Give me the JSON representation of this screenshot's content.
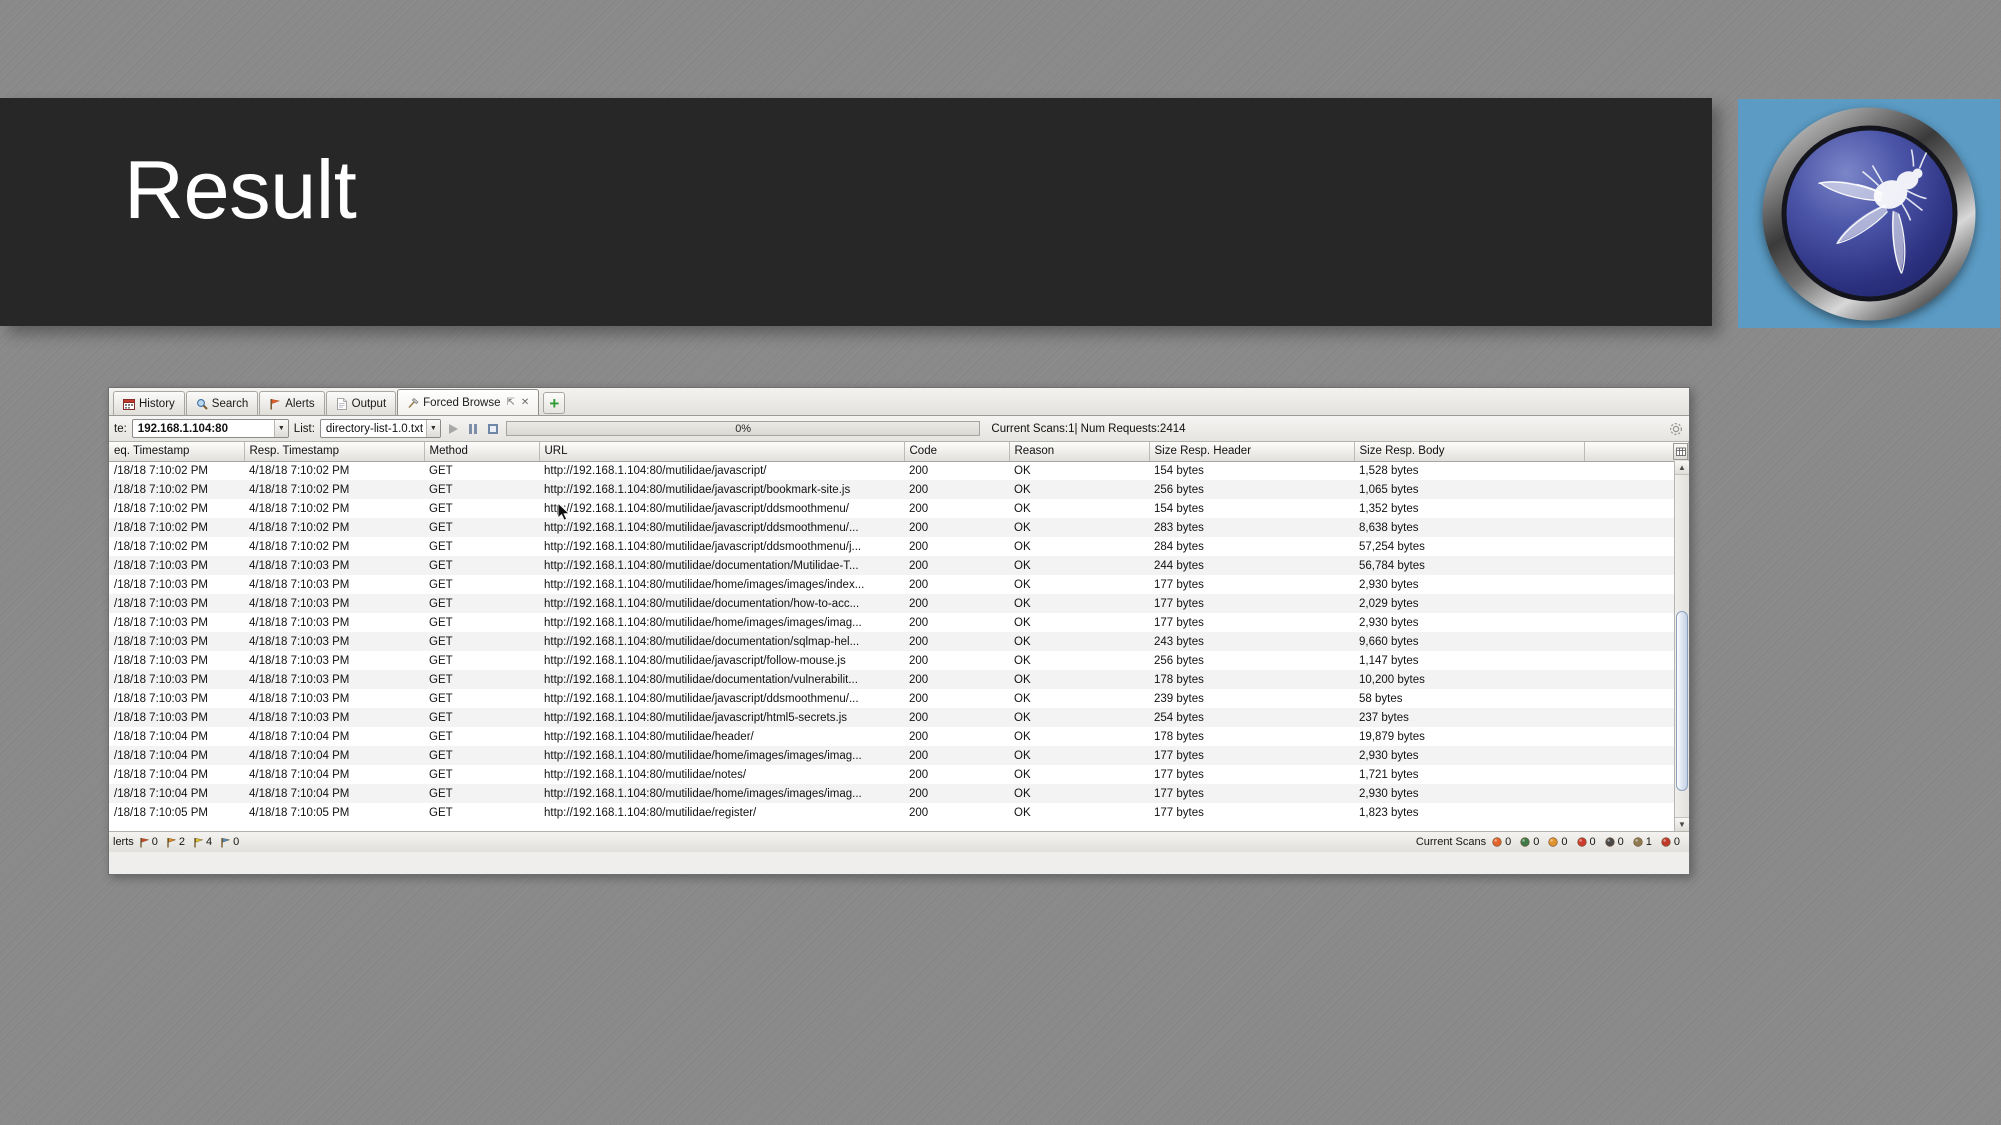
{
  "slide": {
    "title": "Result"
  },
  "logo": {
    "name": "owasp-zap-logo",
    "background_color": "#5b9bc4",
    "disc_color": "#3a4296"
  },
  "app": {
    "tabs": [
      {
        "label": "History",
        "icon": "calendar-icon",
        "active": false,
        "closable": false
      },
      {
        "label": "Search",
        "icon": "magnifier-icon",
        "active": false,
        "closable": false
      },
      {
        "label": "Alerts",
        "icon": "flag-icon",
        "active": false,
        "closable": false
      },
      {
        "label": "Output",
        "icon": "document-icon",
        "active": false,
        "closable": false
      },
      {
        "label": "Forced Browse",
        "icon": "hammer-icon",
        "active": true,
        "closable": true
      }
    ],
    "add_tab_label": "+",
    "toolbar": {
      "site_label": "te:",
      "site_value": "192.168.1.104:80",
      "list_label": "List:",
      "list_value": "directory-list-1.0.txt",
      "progress_text": "0%",
      "progress_percent": 0,
      "scans_text": "Current Scans:1| Num Requests:2414"
    },
    "table": {
      "columns": [
        "eq. Timestamp",
        "Resp. Timestamp",
        "Method",
        "URL",
        "Code",
        "Reason",
        "Size Resp. Header",
        "Size Resp. Body"
      ],
      "rows": [
        [
          "/18/18 7:10:02 PM",
          "4/18/18 7:10:02 PM",
          "GET",
          "http://192.168.1.104:80/mutilidae/javascript/",
          "200",
          "OK",
          "154 bytes",
          "1,528 bytes"
        ],
        [
          "/18/18 7:10:02 PM",
          "4/18/18 7:10:02 PM",
          "GET",
          "http://192.168.1.104:80/mutilidae/javascript/bookmark-site.js",
          "200",
          "OK",
          "256 bytes",
          "1,065 bytes"
        ],
        [
          "/18/18 7:10:02 PM",
          "4/18/18 7:10:02 PM",
          "GET",
          "http://192.168.1.104:80/mutilidae/javascript/ddsmoothmenu/",
          "200",
          "OK",
          "154 bytes",
          "1,352 bytes"
        ],
        [
          "/18/18 7:10:02 PM",
          "4/18/18 7:10:02 PM",
          "GET",
          "http://192.168.1.104:80/mutilidae/javascript/ddsmoothmenu/...",
          "200",
          "OK",
          "283 bytes",
          "8,638 bytes"
        ],
        [
          "/18/18 7:10:02 PM",
          "4/18/18 7:10:02 PM",
          "GET",
          "http://192.168.1.104:80/mutilidae/javascript/ddsmoothmenu/j...",
          "200",
          "OK",
          "284 bytes",
          "57,254 bytes"
        ],
        [
          "/18/18 7:10:03 PM",
          "4/18/18 7:10:03 PM",
          "GET",
          "http://192.168.1.104:80/mutilidae/documentation/Mutilidae-T...",
          "200",
          "OK",
          "244 bytes",
          "56,784 bytes"
        ],
        [
          "/18/18 7:10:03 PM",
          "4/18/18 7:10:03 PM",
          "GET",
          "http://192.168.1.104:80/mutilidae/home/images/images/index...",
          "200",
          "OK",
          "177 bytes",
          "2,930 bytes"
        ],
        [
          "/18/18 7:10:03 PM",
          "4/18/18 7:10:03 PM",
          "GET",
          "http://192.168.1.104:80/mutilidae/documentation/how-to-acc...",
          "200",
          "OK",
          "177 bytes",
          "2,029 bytes"
        ],
        [
          "/18/18 7:10:03 PM",
          "4/18/18 7:10:03 PM",
          "GET",
          "http://192.168.1.104:80/mutilidae/home/images/images/imag...",
          "200",
          "OK",
          "177 bytes",
          "2,930 bytes"
        ],
        [
          "/18/18 7:10:03 PM",
          "4/18/18 7:10:03 PM",
          "GET",
          "http://192.168.1.104:80/mutilidae/documentation/sqlmap-hel...",
          "200",
          "OK",
          "243 bytes",
          "9,660 bytes"
        ],
        [
          "/18/18 7:10:03 PM",
          "4/18/18 7:10:03 PM",
          "GET",
          "http://192.168.1.104:80/mutilidae/javascript/follow-mouse.js",
          "200",
          "OK",
          "256 bytes",
          "1,147 bytes"
        ],
        [
          "/18/18 7:10:03 PM",
          "4/18/18 7:10:03 PM",
          "GET",
          "http://192.168.1.104:80/mutilidae/documentation/vulnerabilit...",
          "200",
          "OK",
          "178 bytes",
          "10,200 bytes"
        ],
        [
          "/18/18 7:10:03 PM",
          "4/18/18 7:10:03 PM",
          "GET",
          "http://192.168.1.104:80/mutilidae/javascript/ddsmoothmenu/...",
          "200",
          "OK",
          "239 bytes",
          "58 bytes"
        ],
        [
          "/18/18 7:10:03 PM",
          "4/18/18 7:10:03 PM",
          "GET",
          "http://192.168.1.104:80/mutilidae/javascript/html5-secrets.js",
          "200",
          "OK",
          "254 bytes",
          "237 bytes"
        ],
        [
          "/18/18 7:10:04 PM",
          "4/18/18 7:10:04 PM",
          "GET",
          "http://192.168.1.104:80/mutilidae/header/",
          "200",
          "OK",
          "178 bytes",
          "19,879 bytes"
        ],
        [
          "/18/18 7:10:04 PM",
          "4/18/18 7:10:04 PM",
          "GET",
          "http://192.168.1.104:80/mutilidae/home/images/images/imag...",
          "200",
          "OK",
          "177 bytes",
          "2,930 bytes"
        ],
        [
          "/18/18 7:10:04 PM",
          "4/18/18 7:10:04 PM",
          "GET",
          "http://192.168.1.104:80/mutilidae/notes/",
          "200",
          "OK",
          "177 bytes",
          "1,721 bytes"
        ],
        [
          "/18/18 7:10:04 PM",
          "4/18/18 7:10:04 PM",
          "GET",
          "http://192.168.1.104:80/mutilidae/home/images/images/imag...",
          "200",
          "OK",
          "177 bytes",
          "2,930 bytes"
        ],
        [
          "/18/18 7:10:05 PM",
          "4/18/18 7:10:05 PM",
          "GET",
          "http://192.168.1.104:80/mutilidae/register/",
          "200",
          "OK",
          "177 bytes",
          "1,823 bytes"
        ]
      ]
    },
    "statusbar": {
      "alerts_label": "lerts",
      "alerts": [
        {
          "level": "high",
          "color": "#d9452b",
          "count": "0"
        },
        {
          "level": "medium",
          "color": "#e88b22",
          "count": "2"
        },
        {
          "level": "low",
          "color": "#e3c72a",
          "count": "4"
        },
        {
          "level": "informational",
          "color": "#4a8fd4",
          "count": "0"
        }
      ],
      "scans_label": "Current Scans",
      "scans": [
        {
          "icon": "flame-icon",
          "color": "#e2632c",
          "count": "0"
        },
        {
          "icon": "download-icon",
          "color": "#3d7a46",
          "count": "0"
        },
        {
          "icon": "fire-drop-icon",
          "color": "#e0922c",
          "count": "0"
        },
        {
          "icon": "target-icon",
          "color": "#cc3b2e",
          "count": "0"
        },
        {
          "icon": "spider-icon",
          "color": "#4a4a4a",
          "count": "0"
        },
        {
          "icon": "hammer-icon",
          "color": "#8d7a50",
          "count": "1"
        },
        {
          "icon": "red-spider-icon",
          "color": "#c0392b",
          "count": "0"
        }
      ]
    }
  }
}
